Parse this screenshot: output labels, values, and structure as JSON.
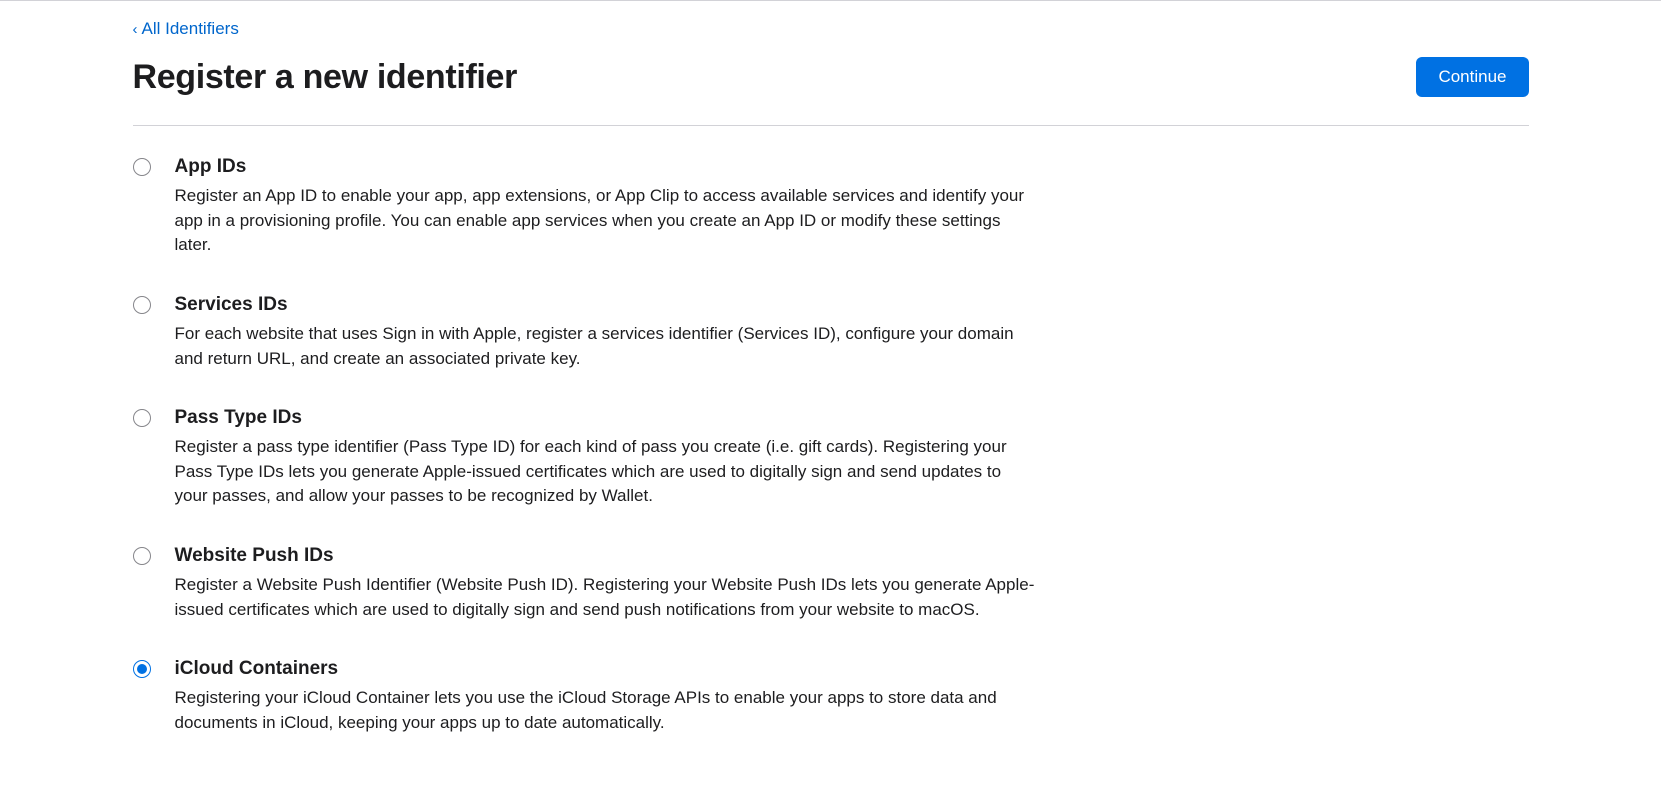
{
  "nav": {
    "back_label": "All Identifiers"
  },
  "header": {
    "title": "Register a new identifier",
    "continue_label": "Continue"
  },
  "options": [
    {
      "id": "app-ids",
      "title": "App IDs",
      "description": "Register an App ID to enable your app, app extensions, or App Clip to access available services and identify your app in a provisioning profile. You can enable app services when you create an App ID or modify these settings later.",
      "selected": false
    },
    {
      "id": "services-ids",
      "title": "Services IDs",
      "description": "For each website that uses Sign in with Apple, register a services identifier (Services ID), configure your domain and return URL, and create an associated private key.",
      "selected": false
    },
    {
      "id": "pass-type-ids",
      "title": "Pass Type IDs",
      "description": "Register a pass type identifier (Pass Type ID) for each kind of pass you create (i.e. gift cards). Registering your Pass Type IDs lets you generate Apple-issued certificates which are used to digitally sign and send updates to your passes, and allow your passes to be recognized by Wallet.",
      "selected": false
    },
    {
      "id": "website-push-ids",
      "title": "Website Push IDs",
      "description": "Register a Website Push Identifier (Website Push ID). Registering your Website Push IDs lets you generate Apple-issued certificates which are used to digitally sign and send push notifications from your website to macOS.",
      "selected": false
    },
    {
      "id": "icloud-containers",
      "title": "iCloud Containers",
      "description": "Registering your iCloud Container lets you use the iCloud Storage APIs to enable your apps to store data and documents in iCloud, keeping your apps up to date automatically.",
      "selected": true
    }
  ]
}
